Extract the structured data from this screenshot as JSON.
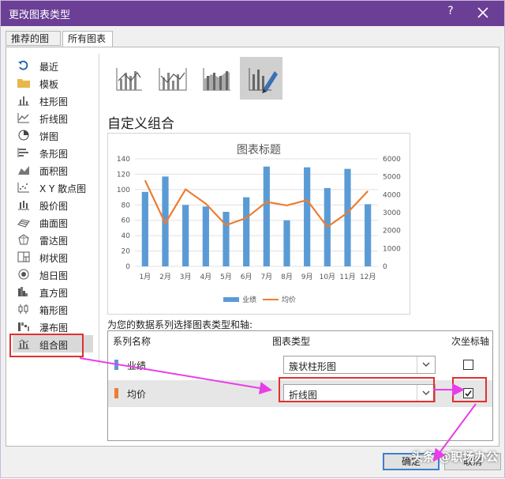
{
  "window": {
    "title": "更改图表类型",
    "help": "?",
    "accent": "#6a3f95"
  },
  "tabs": [
    {
      "label": "推荐的图表"
    },
    {
      "label": "所有图表"
    }
  ],
  "sidebar": {
    "items": [
      {
        "label": "最近",
        "icon": "recent-icon"
      },
      {
        "label": "模板",
        "icon": "folder-icon"
      },
      {
        "label": "柱形图",
        "icon": "column-chart-icon"
      },
      {
        "label": "折线图",
        "icon": "line-chart-icon"
      },
      {
        "label": "饼图",
        "icon": "pie-chart-icon"
      },
      {
        "label": "条形图",
        "icon": "bar-chart-icon"
      },
      {
        "label": "面积图",
        "icon": "area-chart-icon"
      },
      {
        "label": "X Y 散点图",
        "icon": "scatter-chart-icon"
      },
      {
        "label": "股价图",
        "icon": "stock-chart-icon"
      },
      {
        "label": "曲面图",
        "icon": "surface-chart-icon"
      },
      {
        "label": "雷达图",
        "icon": "radar-chart-icon"
      },
      {
        "label": "树状图",
        "icon": "treemap-chart-icon"
      },
      {
        "label": "旭日图",
        "icon": "sunburst-chart-icon"
      },
      {
        "label": "直方图",
        "icon": "histogram-chart-icon"
      },
      {
        "label": "箱形图",
        "icon": "box-chart-icon"
      },
      {
        "label": "瀑布图",
        "icon": "waterfall-chart-icon"
      },
      {
        "label": "组合图",
        "icon": "combo-chart-icon"
      }
    ],
    "selected": "组合图"
  },
  "main": {
    "heading": "自定义组合",
    "choose_label": "为您的数据系列选择图表类型和轴:",
    "table": {
      "headers": [
        "系列名称",
        "图表类型",
        "次坐标轴"
      ],
      "rows": [
        {
          "name": "业绩",
          "color": "#5b9bd5",
          "chart_type": "簇状柱形图",
          "secondary_axis": false
        },
        {
          "name": "均价",
          "color": "#ed7d31",
          "chart_type": "折线图",
          "secondary_axis": true
        }
      ]
    }
  },
  "chart_data": {
    "type": "bar",
    "title": "图表标题",
    "categories": [
      "1月",
      "2月",
      "3月",
      "4月",
      "5月",
      "6月",
      "7月",
      "8月",
      "9月",
      "10月",
      "11月",
      "12月"
    ],
    "series": [
      {
        "name": "业绩",
        "type": "bar",
        "axis": "primary",
        "color": "#5b9bd5",
        "values": [
          97,
          117,
          80,
          78,
          71,
          90,
          130,
          60,
          129,
          102,
          127,
          81
        ]
      },
      {
        "name": "均价",
        "type": "line",
        "axis": "secondary",
        "color": "#ed7d31",
        "values": [
          4800,
          2400,
          4300,
          3500,
          2300,
          2700,
          3600,
          3400,
          3700,
          2200,
          3000,
          4200
        ]
      }
    ],
    "yticks": [
      "0",
      "20",
      "40",
      "60",
      "80",
      "100",
      "120",
      "140"
    ],
    "y2ticks": [
      "0",
      "1000",
      "2000",
      "3000",
      "4000",
      "5000",
      "6000"
    ],
    "ylim": [
      0,
      140
    ],
    "y2lim": [
      0,
      6000
    ],
    "grid": true,
    "legend": "bottom"
  },
  "buttons": {
    "ok": "确定",
    "cancel": "取消"
  },
  "watermark": "头条 @职场办公"
}
